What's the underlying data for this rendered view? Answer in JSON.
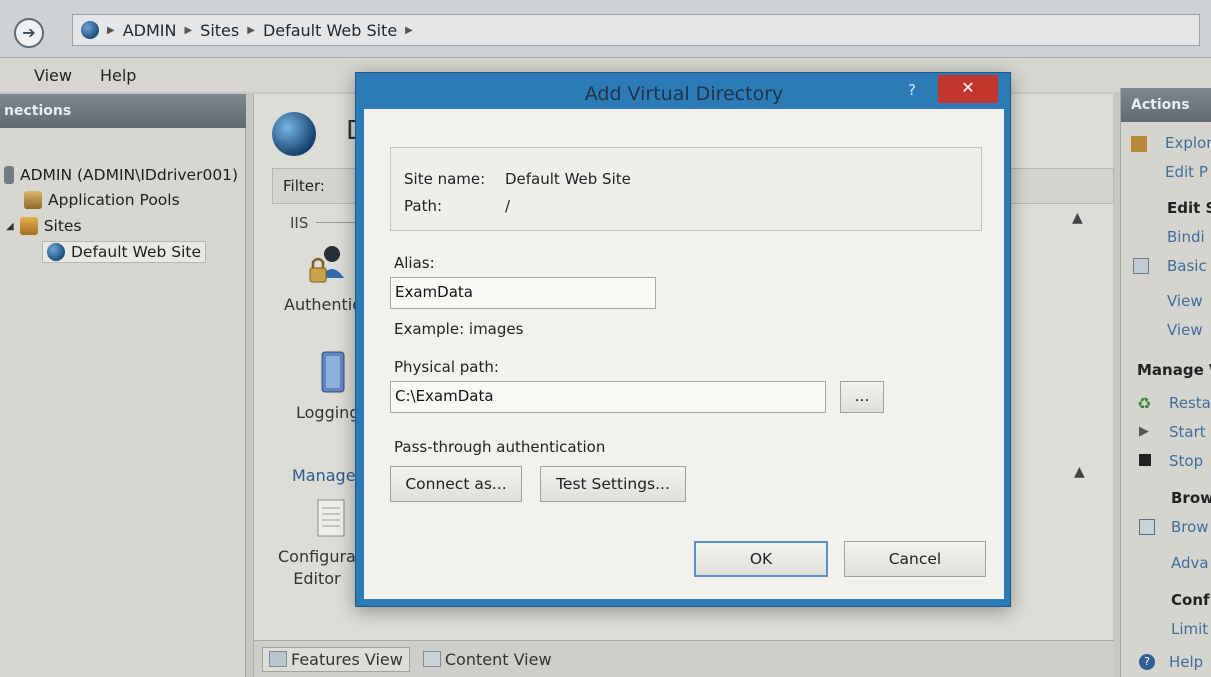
{
  "breadcrumb": [
    "ADMIN",
    "Sites",
    "Default Web Site"
  ],
  "menu": [
    "View",
    "Help"
  ],
  "connections": {
    "header": "nections",
    "tree": [
      {
        "label": "ADMIN (ADMIN\\IDdriver001)"
      },
      {
        "label": "Application Pools"
      },
      {
        "label": "Sites"
      },
      {
        "label": "Default Web Site"
      }
    ]
  },
  "center": {
    "title": "D",
    "filter_label": "Filter:",
    "section_iis": "IIS",
    "features": [
      {
        "label": "Authentic"
      },
      {
        "label": "Logging"
      },
      {
        "label_line1": "Configura",
        "label_line2": "Editor"
      }
    ],
    "manage_label": "Manage",
    "tabs": [
      {
        "label": "Features View"
      },
      {
        "label": "Content View"
      }
    ]
  },
  "actions": {
    "header": "Actions",
    "items": [
      {
        "label": "Explor"
      },
      {
        "label": "Edit P"
      },
      {
        "label": "Edit S"
      },
      {
        "label": "Bindi"
      },
      {
        "label": "Basic"
      },
      {
        "label": "View"
      },
      {
        "label": "View"
      },
      {
        "label": "Manage \\"
      },
      {
        "label": "Resta"
      },
      {
        "label": "Start"
      },
      {
        "label": "Stop"
      },
      {
        "label": "Brow"
      },
      {
        "label": "Brow"
      },
      {
        "label": "Adva"
      },
      {
        "label": "Conf"
      },
      {
        "label": "Limit"
      },
      {
        "label": "Help"
      }
    ]
  },
  "dialog": {
    "title": "Add Virtual Directory",
    "help_glyph": "?",
    "close_glyph": "✕",
    "site_name_label": "Site name:",
    "site_name_value": "Default Web Site",
    "path_label": "Path:",
    "path_value": "/",
    "alias_label": "Alias:",
    "alias_value": "ExamData",
    "example_text": "Example: images",
    "physical_path_label": "Physical path:",
    "physical_path_value": "C:\\ExamData",
    "browse_label": "...",
    "passthrough_label": "Pass-through authentication",
    "connect_as_label": "Connect as...",
    "test_settings_label": "Test Settings...",
    "ok_label": "OK",
    "cancel_label": "Cancel"
  }
}
